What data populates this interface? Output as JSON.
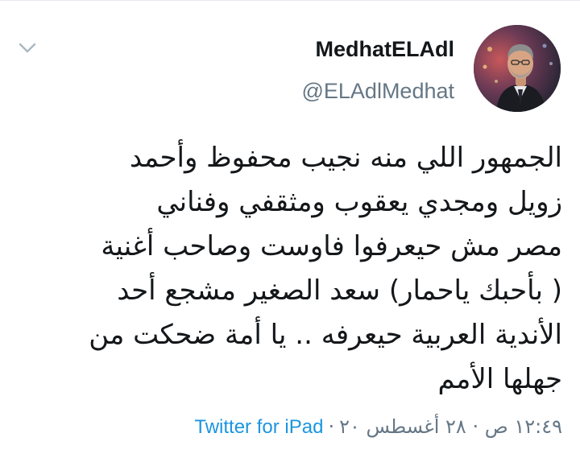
{
  "tweet": {
    "display_name": "MedhatELAdl",
    "handle": "@ELAdlMedhat",
    "text_lines": [
      "الجمهور اللي منه نجيب محفوظ وأحمد",
      "زويل ومجدي يعقوب ومثقفي وفناني",
      "مصر مش حيعرفوا فاوست وصاحب أغنية",
      "( بأحبك ياحمار) سعد الصغير مشجع أحد",
      "الأندية العربية حيعرفه .. يا أمة ضحكت من",
      "جهلها الأمم"
    ],
    "timestamp": "١٢:٤٩ ص · ٢٨ أغسطس ٢٠",
    "separator": "·",
    "source": "Twitter for iPad"
  },
  "icons": {
    "menu": "chevron-down-icon",
    "avatar": "profile-photo"
  },
  "colors": {
    "primary_text": "#14171a",
    "secondary_text": "#657786",
    "link": "#1b95e0",
    "chevron": "#aab8c2"
  }
}
